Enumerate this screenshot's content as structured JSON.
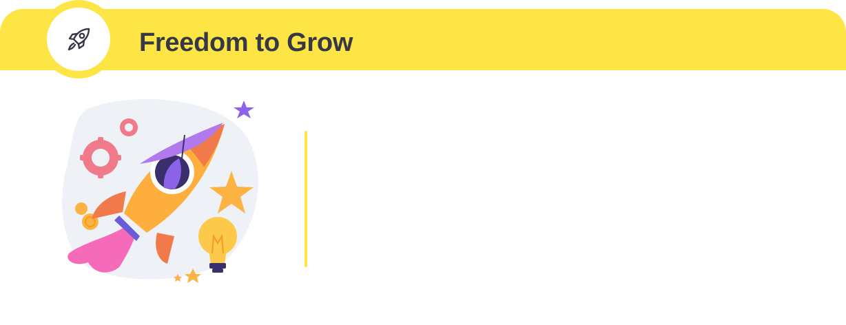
{
  "header": {
    "title": "Freedom to Grow",
    "icon": "rocket-icon",
    "accent_color": "#FEE546",
    "text_color": "#363846"
  },
  "illustration": {
    "subject": "rocket-launch-illustration"
  }
}
